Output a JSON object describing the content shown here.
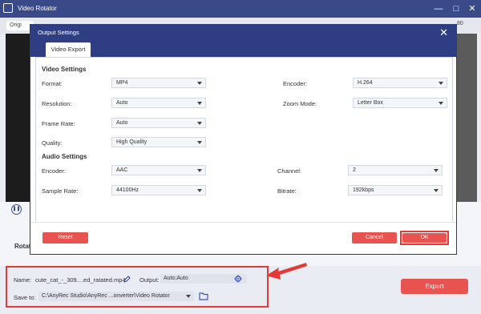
{
  "window": {
    "title": "Video Rotator",
    "tab_left": "Origi",
    "tab_right_partial": "80",
    "rotate_label": "Rotat"
  },
  "dialog": {
    "title": "Output Settings",
    "tab": "Video Export",
    "video_section": "Video Settings",
    "audio_section": "Audio Settings",
    "video": {
      "format": {
        "label": "Format:",
        "value": "MP4"
      },
      "encoder": {
        "label": "Encoder:",
        "value": "H.264"
      },
      "resolution": {
        "label": "Resolution:",
        "value": "Auto"
      },
      "zoom_mode": {
        "label": "Zoom Mode:",
        "value": "Letter Box"
      },
      "frame_rate": {
        "label": "Frame Rate:",
        "value": "Auto"
      },
      "quality": {
        "label": "Quality:",
        "value": "High Quality"
      }
    },
    "audio": {
      "encoder": {
        "label": "Encoder:",
        "value": "AAC"
      },
      "channel": {
        "label": "Channel:",
        "value": "2"
      },
      "sample_rate": {
        "label": "Sample Rate:",
        "value": "44100Hz"
      },
      "bitrate": {
        "label": "Bitrate:",
        "value": "192kbps"
      }
    },
    "buttons": {
      "reset": "Reset",
      "cancel": "Cancel",
      "ok": "OK"
    }
  },
  "bottom": {
    "name_label": "Name:",
    "name_value": "cute_cat_-_309....ed_ratated.mp4",
    "output_label": "Output:",
    "output_value": "Auto;Auto",
    "save_label": "Save to:",
    "save_value": "C:\\AnyRec Studio\\AnyRec ...onverter\\Video Rotator",
    "export": "Export"
  },
  "colors": {
    "accent": "#2f3e82",
    "button_red": "#e8534f",
    "highlight_red": "#e53935"
  },
  "icons": [
    "app-icon",
    "minimize-icon",
    "maximize-icon",
    "close-icon",
    "pause-icon",
    "edit-icon",
    "gear-icon",
    "dropdown-caret-icon",
    "folder-icon",
    "arrow-annotation"
  ]
}
